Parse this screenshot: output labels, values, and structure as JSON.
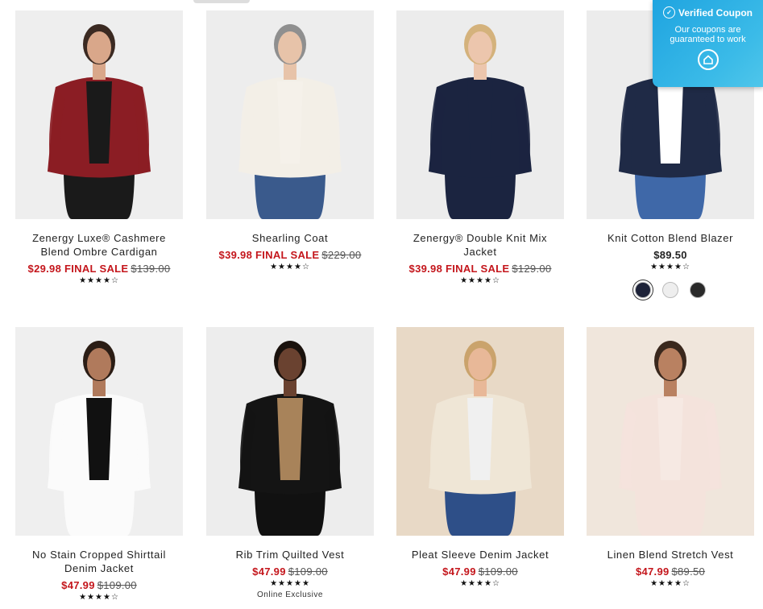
{
  "coupon": {
    "title": "Verified Coupon",
    "message": "Our coupons are guaranteed to work",
    "check_icon": "check-circle-icon",
    "logo_icon": "house-logo-icon"
  },
  "products": [
    {
      "name": "Zenergy Luxe® Cashmere Blend Ombre Cardigan",
      "sale": "$29.98 FINAL SALE",
      "original": "$139.00",
      "stars": "★★★★☆",
      "image": {
        "bg": "#eeeeee",
        "skin": "#d9a78a",
        "hair": "#3b2a22",
        "top": "#8b1d24",
        "inner": "#1a1a1a",
        "bottom": "#1a1a1a"
      }
    },
    {
      "name": "Shearling Coat",
      "sale": "$39.98 FINAL SALE",
      "original": "$229.00",
      "stars": "★★★★☆",
      "image": {
        "bg": "#ededed",
        "skin": "#e7c3a9",
        "hair": "#8f8f8f",
        "top": "#f3efe7",
        "inner": "#f5f1ea",
        "bottom": "#3a5a8c"
      }
    },
    {
      "name": "Zenergy® Double Knit Mix Jacket",
      "sale": "$39.98 FINAL SALE",
      "original": "$129.00",
      "stars": "★★★★☆",
      "image": {
        "bg": "#ececec",
        "skin": "#ecc6ad",
        "hair": "#d4b27c",
        "top": "#1b2440",
        "inner": "#1b2440",
        "bottom": "#1b2440"
      }
    },
    {
      "name": "Knit Cotton Blend Blazer",
      "regular": "$89.50",
      "stars": "★★★★☆",
      "swatches": [
        "#1d2238",
        "#eeeeee",
        "#2a2a2a"
      ],
      "image": {
        "bg": "#ececec",
        "skin": "#d7a88c",
        "hair": "#7b5b3c",
        "top": "#1f2a46",
        "inner": "#ffffff",
        "bottom": "#3f68a8"
      }
    },
    {
      "name": "No Stain Cropped Shirttail Denim Jacket",
      "sale": "$47.99",
      "original": "$109.00",
      "stars": "★★★★☆",
      "image": {
        "bg": "#efefef",
        "skin": "#b07a5c",
        "hair": "#2b1d15",
        "top": "#fbfbfb",
        "inner": "#111111",
        "bottom": "#fbfbfb"
      }
    },
    {
      "name": "Rib Trim Quilted Vest",
      "sale": "$47.99",
      "original": "$109.00",
      "stars": "★★★★★",
      "extra": "Online Exclusive",
      "image": {
        "bg": "#ededed",
        "skin": "#6a4230",
        "hair": "#1a120d",
        "top": "#141414",
        "inner": "#a8835a",
        "bottom": "#111111"
      }
    },
    {
      "name": "Pleat Sleeve Denim Jacket",
      "sale": "$47.99",
      "original": "$109.00",
      "stars": "★★★★☆",
      "image": {
        "bg": "#e8d9c6",
        "skin": "#e8b898",
        "hair": "#caa36c",
        "top": "#efe6d6",
        "inner": "#f0f0f0",
        "bottom": "#2e4f88"
      }
    },
    {
      "name": "Linen Blend Stretch Vest",
      "sale": "$47.99",
      "original": "$89.50",
      "stars": "★★★★☆",
      "image": {
        "bg": "#f0e6dc",
        "skin": "#b98161",
        "hair": "#3a281d",
        "top": "#f4e3dc",
        "inner": "#f6e9e3",
        "bottom": "#f4e3dc"
      }
    }
  ]
}
